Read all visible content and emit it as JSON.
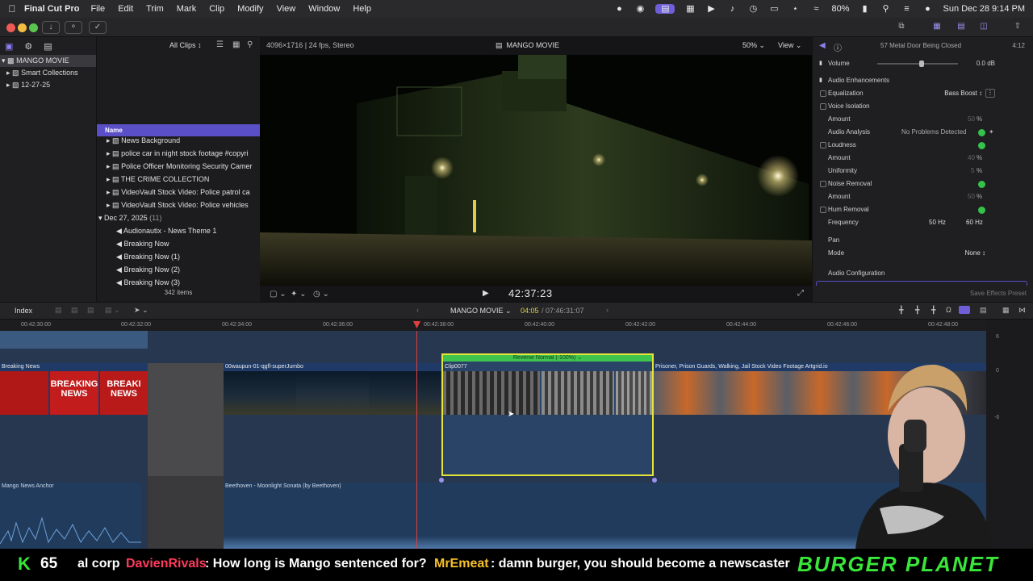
{
  "menubar": {
    "app_name": "Final Cut Pro",
    "items": [
      "File",
      "Edit",
      "Trim",
      "Mark",
      "Clip",
      "Modify",
      "View",
      "Window",
      "Help"
    ],
    "battery": "80%",
    "datetime": "Sun Dec 28  9:14 PM"
  },
  "sidebar": {
    "library": "MANGO MOVIE",
    "items": [
      "Smart Collections",
      "12-27-25"
    ]
  },
  "browser": {
    "filter": "All Clips",
    "column_name": "Name",
    "rows": [
      "News Background",
      "police  car in night stock footage #copyri",
      "Police Officer Monitoring Security Camer",
      "THE CRIME COLLECTION",
      "VideoVault Stock Video:  Police patrol ca",
      "VideoVault Stock Video:  Police vehicles"
    ],
    "group_date": "Dec 27, 2025",
    "group_count": "(11)",
    "audio_rows": [
      "Audionautix - News Theme 1",
      "Breaking Now",
      "Breaking Now (1)",
      "Breaking Now (2)",
      "Breaking Now (3)"
    ],
    "item_count": "342 items"
  },
  "viewer": {
    "format": "4096×1716 | 24 fps, Stereo",
    "title": "MANGO MOVIE",
    "zoom": "50%",
    "view_label": "View",
    "timecode": "42:37:23"
  },
  "inspector": {
    "clip_name": "57 Metal Door Being Closed",
    "clip_duration": "4:12",
    "volume_label": "Volume",
    "volume_value": "0.0 dB",
    "section": "Audio Enhancements",
    "equalization": "Equalization",
    "eq_value": "Bass Boost",
    "voice_isolation": "Voice Isolation",
    "amount": "Amount",
    "amount_value1": "50",
    "percent": "%",
    "audio_analysis": "Audio Analysis",
    "analysis_value": "No Problems Detected",
    "loudness": "Loudness",
    "amount_value2": "40",
    "uniformity": "Uniformity",
    "uniformity_value": "5",
    "noise_removal": "Noise Removal",
    "amount_value3": "50",
    "hum_removal": "Hum Removal",
    "frequency": "Frequency",
    "freq_50": "50",
    "freq_60": "60",
    "hz": "Hz",
    "pan": "Pan",
    "mode": "Mode",
    "mode_value": "None",
    "audio_config": "Audio Configuration",
    "save_preset": "Save Effects Preset"
  },
  "timeline": {
    "index_label": "Index",
    "project_name": "MANGO MOVIE",
    "position": "04:05",
    "duration": "/ 07:46:31:07",
    "ruler_ticks": [
      "00:42:30:00",
      "00:42:32:00",
      "00:42:34:00",
      "00:42:36:00",
      "00:42:38:00",
      "00:42:40:00",
      "00:42:42:00",
      "00:42:44:00",
      "00:42:46:00",
      "00:42:48:00"
    ],
    "meter_labels": [
      "6",
      "0",
      "-6"
    ],
    "clips": {
      "breaking_news": "Breaking News",
      "breaking_text": "BREAKING NEWS",
      "breaking_text_partial": "BREAKI NEWS",
      "jumbo": "00waupun-01-qgfl-superJumbo",
      "clip0077": "Clip0077",
      "retime": "Reverse Normal (-100%)",
      "prisoner": "Prisoner, Prison Guards, Walking, Jail  Stock Video Footage  Artgrid.io",
      "anchor": "Mango News Anchor",
      "beethoven": "Beethoven - Moonlight Sonata (by Beethoven)"
    }
  },
  "banner": {
    "logo_letter": "K",
    "count": "65",
    "prev_fragment": "al corp",
    "user1": "DavienRivals",
    "msg1": ": How long is Mango sentenced for?",
    "user2": "MrEmeat",
    "msg2": ": damn burger, you should become a newscaster",
    "brand": "BURGER PLANET"
  },
  "colors": {
    "accent": "#6e5fd8",
    "selection_yellow": "#e6e63a",
    "retime_green": "#35c24a",
    "playhead": "#e04040",
    "user1": "#ff3b5c",
    "user2": "#f7c12b",
    "brand_green": "#39e63a"
  }
}
